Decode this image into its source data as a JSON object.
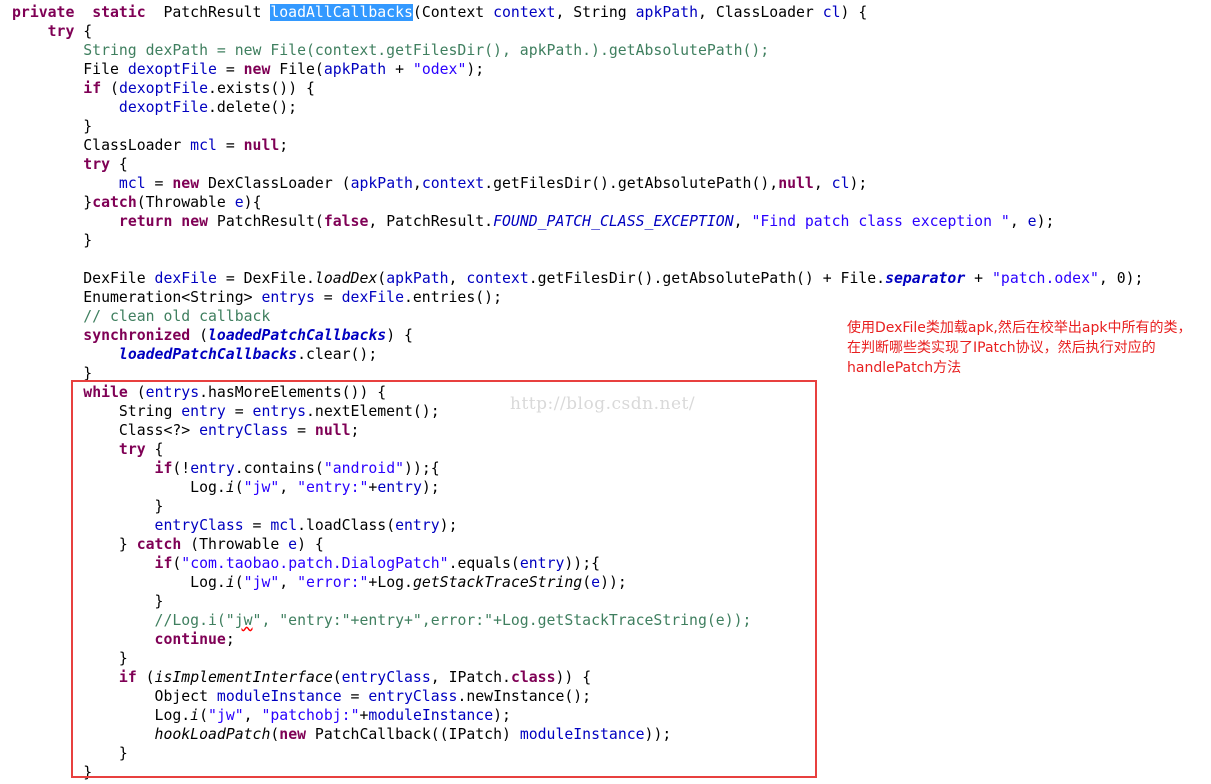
{
  "colors": {
    "keyword": "#7f0055",
    "field": "#0000c0",
    "string": "#2a00ff",
    "comment": "#3f7f5f",
    "selection": "#3399ff",
    "highlight_box": "#e8403f",
    "annotation": "#e82020",
    "watermark": "#d9d9d9"
  },
  "watermark": "http://blog.csdn.net/",
  "annotation": "使用DexFile类加载apk,然后在校举出apk中所有的类，在判断哪些类实现了IPatch协议，然后执行对应的handlePatch方法",
  "code_lines": [
    [
      [
        "kw",
        "private"
      ],
      [
        "",
        "  "
      ],
      [
        "kw",
        "static"
      ],
      [
        "",
        "  PatchResult "
      ],
      [
        "sel",
        "loadAllCallbacks"
      ],
      [
        "",
        "(Context "
      ],
      [
        "fld",
        "context"
      ],
      [
        "",
        ", String "
      ],
      [
        "fld",
        "apkPath"
      ],
      [
        "",
        ", ClassLoader "
      ],
      [
        "fld",
        "cl"
      ],
      [
        "",
        ") {"
      ]
    ],
    [
      [
        "",
        "    "
      ],
      [
        "kw",
        "try"
      ],
      [
        "",
        " {"
      ]
    ],
    [
      [
        "cmt",
        "        String dexPath = new File(context.getFilesDir(), apkPath.).getAbsolutePath();"
      ]
    ],
    [
      [
        "",
        "        File "
      ],
      [
        "fld",
        "dexoptFile"
      ],
      [
        "",
        " = "
      ],
      [
        "kw",
        "new"
      ],
      [
        "",
        " File("
      ],
      [
        "fld",
        "apkPath"
      ],
      [
        "",
        " + "
      ],
      [
        "str",
        "\"odex\""
      ],
      [
        "",
        ");"
      ]
    ],
    [
      [
        "",
        "        "
      ],
      [
        "kw",
        "if"
      ],
      [
        "",
        " ("
      ],
      [
        "fld",
        "dexoptFile"
      ],
      [
        "",
        ".exists()) {"
      ]
    ],
    [
      [
        "",
        "            "
      ],
      [
        "fld",
        "dexoptFile"
      ],
      [
        "",
        ".delete();"
      ]
    ],
    [
      [
        "",
        "        }"
      ]
    ],
    [
      [
        "",
        "        ClassLoader "
      ],
      [
        "fld",
        "mcl"
      ],
      [
        "",
        " = "
      ],
      [
        "kw",
        "null"
      ],
      [
        "",
        ";"
      ]
    ],
    [
      [
        "",
        "        "
      ],
      [
        "kw",
        "try"
      ],
      [
        "",
        " {"
      ]
    ],
    [
      [
        "",
        "            "
      ],
      [
        "fld",
        "mcl"
      ],
      [
        "",
        " = "
      ],
      [
        "kw",
        "new"
      ],
      [
        "",
        " DexClassLoader ("
      ],
      [
        "fld",
        "apkPath"
      ],
      [
        "",
        ","
      ],
      [
        "fld",
        "context"
      ],
      [
        "",
        ".getFilesDir().getAbsolutePath(),"
      ],
      [
        "kw",
        "null"
      ],
      [
        "",
        ", "
      ],
      [
        "fld",
        "cl"
      ],
      [
        "",
        ");"
      ]
    ],
    [
      [
        "",
        "        }"
      ],
      [
        "kw",
        "catch"
      ],
      [
        "",
        "(Throwable "
      ],
      [
        "fld",
        "e"
      ],
      [
        "",
        "){"
      ]
    ],
    [
      [
        "",
        "            "
      ],
      [
        "kw",
        "return"
      ],
      [
        "",
        " "
      ],
      [
        "kw",
        "new"
      ],
      [
        "",
        " PatchResult("
      ],
      [
        "kw",
        "false"
      ],
      [
        "",
        ", PatchResult."
      ],
      [
        "sfi",
        "FOUND_PATCH_CLASS_EXCEPTION"
      ],
      [
        "",
        ", "
      ],
      [
        "str",
        "\"Find patch class exception \""
      ],
      [
        "",
        ", "
      ],
      [
        "fld",
        "e"
      ],
      [
        "",
        ");"
      ]
    ],
    [
      [
        "",
        "        }"
      ]
    ],
    [
      [
        "",
        ""
      ]
    ],
    [
      [
        "",
        "        DexFile "
      ],
      [
        "fld",
        "dexFile"
      ],
      [
        "",
        " = DexFile."
      ],
      [
        "itl",
        "loadDex"
      ],
      [
        "",
        "("
      ],
      [
        "fld",
        "apkPath"
      ],
      [
        "",
        ", "
      ],
      [
        "fld",
        "context"
      ],
      [
        "",
        ".getFilesDir().getAbsolutePath() + File."
      ],
      [
        "sfb",
        "separator"
      ],
      [
        "",
        " + "
      ],
      [
        "str",
        "\"patch.odex\""
      ],
      [
        "",
        ", 0);"
      ]
    ],
    [
      [
        "",
        "        Enumeration<String> "
      ],
      [
        "fld",
        "entrys"
      ],
      [
        "",
        " = "
      ],
      [
        "fld",
        "dexFile"
      ],
      [
        "",
        ".entries();"
      ]
    ],
    [
      [
        "cmt",
        "        // clean old callback"
      ]
    ],
    [
      [
        "",
        "        "
      ],
      [
        "kw",
        "synchronized"
      ],
      [
        "",
        " ("
      ],
      [
        "sfb",
        "loadedPatchCallbacks"
      ],
      [
        "",
        ") {"
      ]
    ],
    [
      [
        "",
        "            "
      ],
      [
        "sfb",
        "loadedPatchCallbacks"
      ],
      [
        "",
        ".clear();"
      ]
    ],
    [
      [
        "",
        "        }"
      ]
    ],
    [
      [
        "",
        "        "
      ],
      [
        "kw",
        "while"
      ],
      [
        "",
        " ("
      ],
      [
        "fld",
        "entrys"
      ],
      [
        "",
        ".hasMoreElements()) {"
      ]
    ],
    [
      [
        "",
        "            String "
      ],
      [
        "fld",
        "entry"
      ],
      [
        "",
        " = "
      ],
      [
        "fld",
        "entrys"
      ],
      [
        "",
        ".nextElement();"
      ]
    ],
    [
      [
        "",
        "            Class<?> "
      ],
      [
        "fld",
        "entryClass"
      ],
      [
        "",
        " = "
      ],
      [
        "kw",
        "null"
      ],
      [
        "",
        ";"
      ]
    ],
    [
      [
        "",
        "            "
      ],
      [
        "kw",
        "try"
      ],
      [
        "",
        " {"
      ]
    ],
    [
      [
        "",
        "                "
      ],
      [
        "kw",
        "if"
      ],
      [
        "",
        "(!"
      ],
      [
        "fld",
        "entry"
      ],
      [
        "",
        ".contains("
      ],
      [
        "str",
        "\"android\""
      ],
      [
        "",
        "));{"
      ]
    ],
    [
      [
        "",
        "                    Log."
      ],
      [
        "itl",
        "i"
      ],
      [
        "",
        "("
      ],
      [
        "str",
        "\"jw\""
      ],
      [
        "",
        ", "
      ],
      [
        "str",
        "\"entry:\""
      ],
      [
        "",
        "+"
      ],
      [
        "fld",
        "entry"
      ],
      [
        "",
        ");"
      ]
    ],
    [
      [
        "",
        "                }"
      ]
    ],
    [
      [
        "",
        "                "
      ],
      [
        "fld",
        "entryClass"
      ],
      [
        "",
        " = "
      ],
      [
        "fld",
        "mcl"
      ],
      [
        "",
        ".loadClass("
      ],
      [
        "fld",
        "entry"
      ],
      [
        "",
        ");"
      ]
    ],
    [
      [
        "",
        "            } "
      ],
      [
        "kw",
        "catch"
      ],
      [
        "",
        " (Throwable "
      ],
      [
        "fld",
        "e"
      ],
      [
        "",
        ") {"
      ]
    ],
    [
      [
        "",
        "                "
      ],
      [
        "kw",
        "if"
      ],
      [
        "",
        "("
      ],
      [
        "str",
        "\"com.taobao.patch.DialogPatch\""
      ],
      [
        "",
        ".equals("
      ],
      [
        "fld",
        "entry"
      ],
      [
        "",
        "));{"
      ]
    ],
    [
      [
        "",
        "                    Log."
      ],
      [
        "itl",
        "i"
      ],
      [
        "",
        "("
      ],
      [
        "str",
        "\"jw\""
      ],
      [
        "",
        ", "
      ],
      [
        "str",
        "\"error:\""
      ],
      [
        "",
        "+Log."
      ],
      [
        "itl",
        "getStackTraceString"
      ],
      [
        "",
        "("
      ],
      [
        "fld",
        "e"
      ],
      [
        "",
        "));"
      ]
    ],
    [
      [
        "",
        "                }"
      ]
    ],
    [
      [
        "cmt",
        "                //Log.i(\""
      ],
      [
        "cmt squig",
        "jw"
      ],
      [
        "cmt",
        "\", \"entry:\"+entry+\",error:\"+Log.getStackTraceString(e));"
      ]
    ],
    [
      [
        "",
        "                "
      ],
      [
        "kw",
        "continue"
      ],
      [
        "",
        ";"
      ]
    ],
    [
      [
        "",
        "            }"
      ]
    ],
    [
      [
        "",
        "            "
      ],
      [
        "kw",
        "if"
      ],
      [
        "",
        " ("
      ],
      [
        "itl",
        "isImplementInterface"
      ],
      [
        "",
        "("
      ],
      [
        "fld",
        "entryClass"
      ],
      [
        "",
        ", IPatch."
      ],
      [
        "kw",
        "class"
      ],
      [
        "",
        "))"
      ],
      [
        "",
        " {"
      ]
    ],
    [
      [
        "",
        "                Object "
      ],
      [
        "fld",
        "moduleInstance"
      ],
      [
        "",
        " = "
      ],
      [
        "fld",
        "entryClass"
      ],
      [
        "",
        ".newInstance();"
      ]
    ],
    [
      [
        "",
        "                Log."
      ],
      [
        "itl",
        "i"
      ],
      [
        "",
        "("
      ],
      [
        "str",
        "\"jw\""
      ],
      [
        "",
        ", "
      ],
      [
        "str",
        "\"patchobj:\""
      ],
      [
        "",
        "+"
      ],
      [
        "fld",
        "moduleInstance"
      ],
      [
        "",
        ");"
      ]
    ],
    [
      [
        "",
        "                "
      ],
      [
        "itl",
        "hookLoadPatch"
      ],
      [
        "",
        "("
      ],
      [
        "kw",
        "new"
      ],
      [
        "",
        " PatchCallback((IPatch) "
      ],
      [
        "fld",
        "moduleInstance"
      ],
      [
        "",
        "));"
      ]
    ],
    [
      [
        "",
        "            }"
      ]
    ],
    [
      [
        "",
        "        }"
      ]
    ]
  ]
}
